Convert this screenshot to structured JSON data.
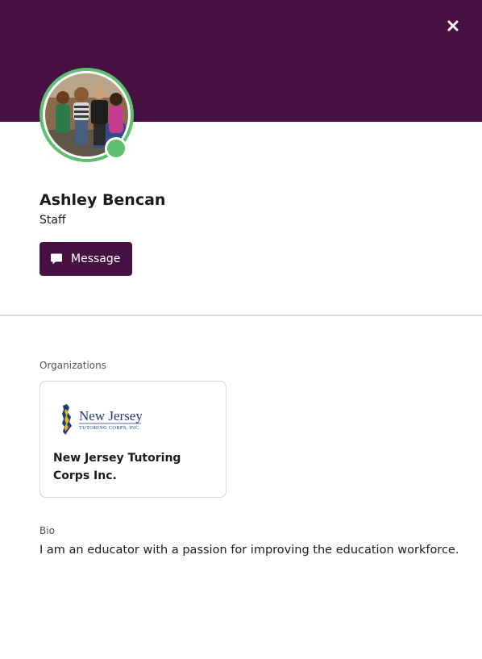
{
  "header": {
    "close_icon": "close-icon",
    "brand_color": "#461142"
  },
  "profile": {
    "avatar_icon": "avatar-photo",
    "status": "online",
    "status_color": "#5cc06e",
    "name": "Ashley Bencan",
    "role": "Staff",
    "message_button": {
      "label": "Message",
      "icon": "chat-bubble-icon"
    }
  },
  "organizations": {
    "label": "Organizations",
    "items": [
      {
        "name": "New Jersey Tutoring Corps Inc.",
        "logo": {
          "title": "New Jersey",
          "subtitle": "TUTORING CORPS, INC."
        }
      }
    ]
  },
  "bio": {
    "label": "Bio",
    "text": "I am an educator with a passion for improving the education workforce."
  }
}
